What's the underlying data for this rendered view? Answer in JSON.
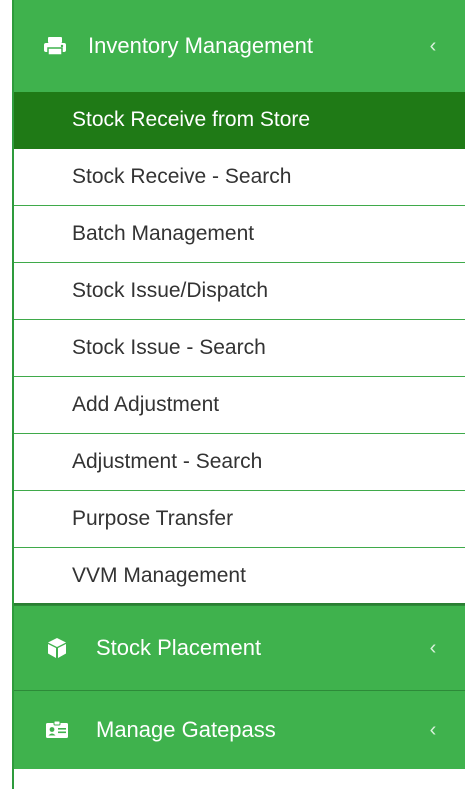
{
  "menu": {
    "inventory": {
      "label": "Inventory Management",
      "icon": "printer-icon",
      "chevron": "‹",
      "items": [
        {
          "label": "Stock Receive from Store",
          "active": true
        },
        {
          "label": "Stock Receive - Search"
        },
        {
          "label": "Batch Management"
        },
        {
          "label": "Stock Issue/Dispatch"
        },
        {
          "label": "Stock Issue - Search"
        },
        {
          "label": "Add Adjustment"
        },
        {
          "label": "Adjustment - Search"
        },
        {
          "label": "Purpose Transfer"
        },
        {
          "label": "VVM Management"
        }
      ]
    },
    "placement": {
      "label": "Stock Placement",
      "icon": "cube-icon",
      "chevron": "‹"
    },
    "gatepass": {
      "label": "Manage Gatepass",
      "icon": "id-card-icon",
      "chevron": "‹"
    }
  },
  "colors": {
    "header_green": "#3fb24d",
    "active_green": "#1f7a16",
    "divider_green": "#3faa4a"
  }
}
